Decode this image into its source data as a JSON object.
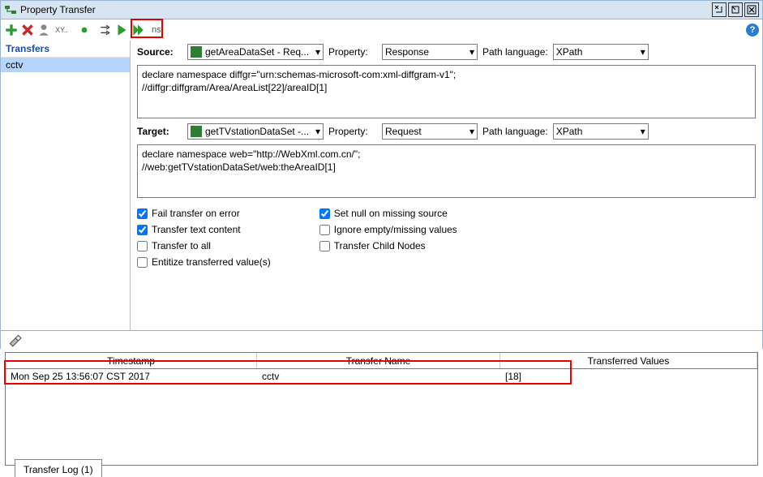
{
  "window": {
    "title": "Property Transfer"
  },
  "toolbar": {
    "ns_label": "ns:"
  },
  "left": {
    "header": "Transfers",
    "items": [
      "cctv"
    ],
    "selected": 0
  },
  "source": {
    "label": "Source:",
    "step": "getAreaDataSet - Req...",
    "propLabel": "Property:",
    "prop": "Response",
    "pathLabel": "Path language:",
    "path": "XPath",
    "code": "declare namespace diffgr=\"urn:schemas-microsoft-com:xml-diffgram-v1\";\n//diffgr:diffgram/Area/AreaList[22]/areaID[1]"
  },
  "target": {
    "label": "Target:",
    "step": "getTVstationDataSet -...",
    "propLabel": "Property:",
    "prop": "Request",
    "pathLabel": "Path language:",
    "path": "XPath",
    "code": "declare namespace web=\"http://WebXml.com.cn/\";\n//web:getTVstationDataSet/web:theAreaID[1]"
  },
  "checks": {
    "failOnError": {
      "label": "Fail transfer on error",
      "checked": true
    },
    "textContent": {
      "label": "Transfer text content",
      "checked": true
    },
    "toAll": {
      "label": "Transfer to all",
      "checked": false
    },
    "entitize": {
      "label": "Entitize transferred value(s)",
      "checked": false
    },
    "setNull": {
      "label": "Set null on missing source",
      "checked": true
    },
    "ignoreEmpty": {
      "label": "Ignore empty/missing values",
      "checked": false
    },
    "childNodes": {
      "label": "Transfer Child Nodes",
      "checked": false
    }
  },
  "results": {
    "headers": [
      "Timestamp",
      "Transfer Name",
      "Transferred Values"
    ],
    "rows": [
      {
        "ts": "Mon Sep 25 13:56:07 CST 2017",
        "name": "cctv",
        "values": "[18]"
      }
    ]
  },
  "bottomTab": {
    "label": "Transfer Log (1)"
  }
}
